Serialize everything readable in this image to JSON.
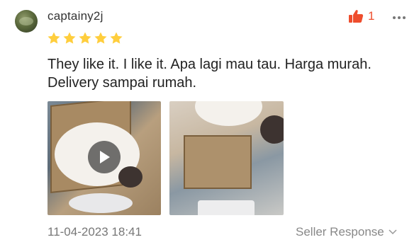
{
  "review": {
    "username": "captainy2j",
    "like_count": "1",
    "rating": 5,
    "text": "They like it. I like it. Apa lagi mau tau. Harga murah. Delivery sampai rumah.",
    "date": "11-04-2023 18:41",
    "seller_response_label": "Seller Response"
  },
  "icons": {
    "like": "thumbs-up-icon",
    "more": "more-dots-icon",
    "star": "star-icon",
    "play": "play-icon",
    "chevron": "chevron-down-icon"
  },
  "colors": {
    "accent": "#ee4d2d",
    "star": "#ffce3d"
  }
}
